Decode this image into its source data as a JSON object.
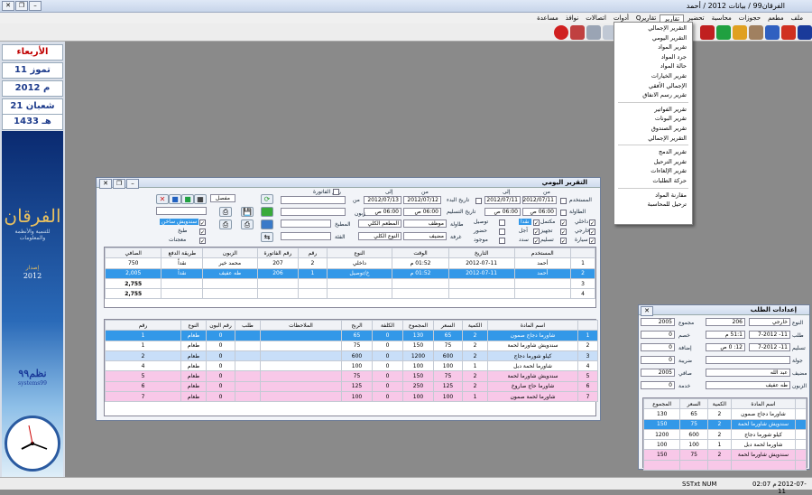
{
  "window": {
    "title": "الفرقان99 / بيانات 2012 / أحمد"
  },
  "menubar": {
    "items": [
      "ملف",
      "مطعم",
      "حجوزات",
      "محاسبة",
      "تحضير",
      "تقارير",
      "تقاريرQ",
      "أدوات",
      "اتصالات",
      "نوافذ",
      "مساعدة"
    ],
    "active": 5
  },
  "dropdown": {
    "groups": [
      [
        "التقرير الإجمالي",
        "التقرير اليومي",
        "تقرير المواد",
        "جرد المواد",
        "حالة المواد",
        "تقرير الخيارات",
        "الإجمالي الأفقي",
        "تقرير رسم الانفاق"
      ],
      [
        "تقرير الفواتير",
        "تقرير البونات",
        "تقرير الصندوق",
        "التقرير الإجمالي"
      ],
      [
        "تقرير الدمج",
        "تقرير الترحيل",
        "تقرير الإلغاءات",
        "حركة الطلبات"
      ],
      [
        "مقارنة المواد",
        "ترحيل للمحاسبة"
      ]
    ]
  },
  "left": {
    "day": "الأربعاء",
    "greg_day": "11 تموز",
    "greg_year": "2012 م",
    "hijri_day": "21 شعبان",
    "hijri_year": "1433 هـ",
    "brand": "الفرقان",
    "brand_sub": "للتنمية والأنظمة والمعلومات",
    "edition": "إصدار",
    "edition_year": "2012",
    "systems": "نظم٩٩",
    "systems_en": "systems99"
  },
  "daily": {
    "title": "التقرير اليومي",
    "filters": {
      "user_lbl": "المستخدم",
      "table_lbl": "الطاولة",
      "from": "من",
      "to": "إلى",
      "date_from": "2012/07/11",
      "date_to": "2012/07/11",
      "date_from2": "2012/07/12",
      "date_to2": "2012/07/13",
      "time_from": "06:00 ص",
      "time_to": "06:00 ص",
      "lbl_from_dt": "تاريخ البدء",
      "lbl_to_dt": "تاريخ التسليم",
      "invoice": "رقم الفاتورة",
      "customer": "زبون",
      "dine_in": "داخلي",
      "external": "خارجي",
      "delivery": "سيارة",
      "done": "مكتمل",
      "prepared": "تجهيز",
      "delivered": "تسليم",
      "cash": "نقداً",
      "credit": "آجل",
      "paid": "سدد",
      "conn": "توصيل",
      "pres": "حضور",
      "avail": "موجود",
      "table": "طاولة",
      "room": "غرفة",
      "employee": "موظف",
      "guest": "مضيف",
      "kitchen": "المطبخ",
      "all_kitchen": "المطعم الكلي",
      "types": "النوع الكلي",
      "category": "الفئة",
      "item_type": "نوع",
      "menu": "مفصل",
      "menu_items": [
        "سندويش ساخن",
        "طبخ",
        "معجنات"
      ]
    },
    "top_cols": [
      "المستخدم",
      "التاريخ",
      "الوقت",
      "النوع",
      "رقم",
      "رقم الفاتورة",
      "الزبون",
      "طريقة الدفع",
      "الصافي"
    ],
    "top_rows": [
      {
        "n": "1",
        "user": "أحمد",
        "date": "2012-07-11",
        "time": "01:52 م",
        "type": "داخلي",
        "num": "2",
        "inv": "207",
        "cust": "محمد خير",
        "pay": "نقداً",
        "net": "750"
      },
      {
        "n": "2",
        "user": "أحمد",
        "date": "2012-07-11",
        "time": "01:52 م",
        "type": "خ/توصيل",
        "num": "1",
        "inv": "206",
        "cust": "طه عفيف",
        "pay": "نقداً",
        "net": "2,005"
      },
      {
        "n": "3",
        "user": "",
        "date": "",
        "time": "",
        "type": "",
        "num": "",
        "inv": "",
        "cust": "",
        "pay": "",
        "net": "2,755"
      },
      {
        "n": "4",
        "user": "",
        "date": "",
        "time": "",
        "type": "",
        "num": "",
        "inv": "",
        "cust": "",
        "pay": "",
        "net": "2,755"
      }
    ],
    "bot_cols": [
      "اسم المادة",
      "الكمية",
      "السعر",
      "المجموع",
      "الكلفة",
      "الربح",
      "الملاحظات",
      "طلب",
      "رقم البون",
      "النوع",
      "رقم"
    ],
    "bot_rows": [
      {
        "n": "1",
        "name": "شاورما دجاج صمون",
        "qty": "2",
        "price": "65",
        "sum": "130",
        "cost": "0",
        "profit": "65",
        "bon": "0",
        "type": "طعام",
        "num": "1",
        "cls": "sel"
      },
      {
        "n": "2",
        "name": "سندويش شاورما لحمة",
        "qty": "2",
        "price": "75",
        "sum": "150",
        "cost": "0",
        "profit": "75",
        "bon": "0",
        "type": "طعام",
        "num": "1",
        "cls": "wht"
      },
      {
        "n": "3",
        "name": "كيلو شورما دجاج",
        "qty": "2",
        "price": "600",
        "sum": "1200",
        "cost": "0",
        "profit": "600",
        "bon": "0",
        "type": "طعام",
        "num": "2",
        "cls": "blue"
      },
      {
        "n": "4",
        "name": "شاورما لحمة دبل",
        "qty": "1",
        "price": "100",
        "sum": "100",
        "cost": "0",
        "profit": "100",
        "bon": "0",
        "type": "طعام",
        "num": "4",
        "cls": "wht"
      },
      {
        "n": "5",
        "name": "سندويش شاورما لحمة",
        "qty": "2",
        "price": "75",
        "sum": "150",
        "cost": "0",
        "profit": "75",
        "bon": "0",
        "type": "طعام",
        "num": "5",
        "cls": "pink"
      },
      {
        "n": "6",
        "name": "شاورما حاج صاروخ",
        "qty": "2",
        "price": "125",
        "sum": "250",
        "cost": "0",
        "profit": "125",
        "bon": "0",
        "type": "طعام",
        "num": "6",
        "cls": "pink"
      },
      {
        "n": "7",
        "name": "شاورما لحمة صمون",
        "qty": "1",
        "price": "100",
        "sum": "100",
        "cost": "0",
        "profit": "100",
        "bon": "0",
        "type": "طعام",
        "num": "7",
        "cls": "pink"
      }
    ]
  },
  "order": {
    "title": "إعدادات الطلب",
    "type_lbl": "النوع",
    "type_val": "خارجي",
    "num": "206",
    "total_lbl": "مجموع",
    "total": "2005",
    "request_lbl": "طلب",
    "req_date": "11- 7-2012",
    "req_time": "51:1 م",
    "disc_lbl": "خصم",
    "disc": "0",
    "deliver_lbl": "تسليم",
    "del_date": "11- 7-2012",
    "del_time": "12: 0 ص",
    "add_lbl": "إضافة",
    "add": "0",
    "party_lbl": "جولة",
    "tax_lbl": "ضريبة",
    "tax": "0",
    "guest_lbl": "مضيف",
    "guest": "عبد الله",
    "net_lbl": "صافي",
    "net": "2005",
    "cust_lbl": "الزبون",
    "cust": "طه عفيف",
    "svc_lbl": "خدمة",
    "svc": "0",
    "cols": [
      "اسم المادة",
      "الكمية",
      "السعر",
      "المجموع"
    ],
    "rows": [
      {
        "name": "شاورما دجاج صمون",
        "qty": "2",
        "price": "65",
        "sum": "130",
        "cls": "wht"
      },
      {
        "name": "سندويش شاورما لحمة",
        "qty": "2",
        "price": "75",
        "sum": "150",
        "cls": "sel"
      },
      {
        "name": "كيلو شورما دجاج",
        "qty": "2",
        "price": "600",
        "sum": "1200",
        "cls": "wht"
      },
      {
        "name": "شاورما لحمة دبل",
        "qty": "1",
        "price": "100",
        "sum": "100",
        "cls": "wht"
      },
      {
        "name": "سندويش شاورما لحمة",
        "qty": "2",
        "price": "75",
        "sum": "150",
        "cls": "pink"
      },
      {
        "name": "",
        "qty": "",
        "price": "",
        "sum": "",
        "cls": "pink"
      }
    ]
  },
  "status": {
    "sstxt": "SSTxt",
    "num": "NUM",
    "time": "02:07 م",
    "date": "2012-07-11"
  }
}
